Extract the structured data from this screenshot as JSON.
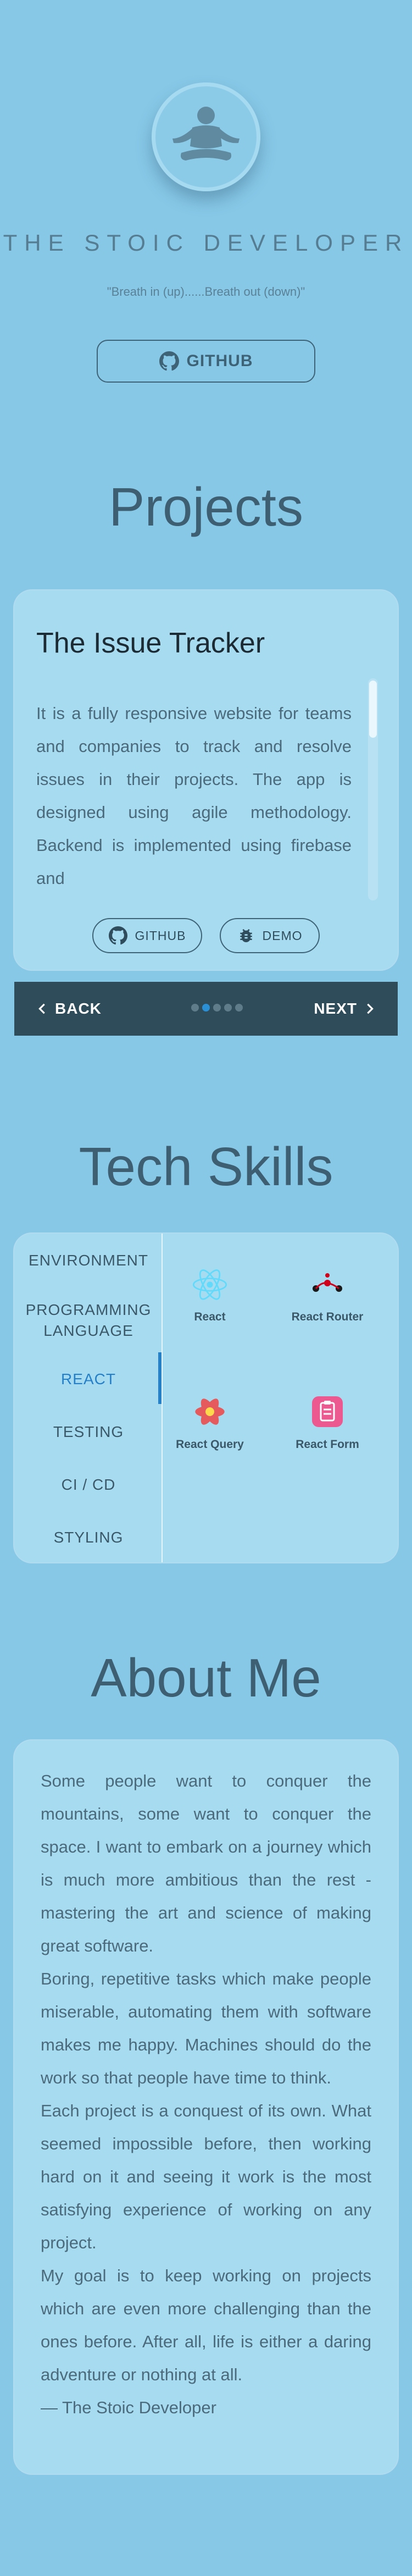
{
  "header": {
    "title": "THE STOIC DEVELOPER",
    "quote": "\"Breath in (up)......Breath out (down)\"",
    "github_label": "GITHUB"
  },
  "projects": {
    "heading": "Projects",
    "current": {
      "title": "The Issue Tracker",
      "description": "It is a fully responsive website for teams and companies to track and resolve issues in their projects. The app is designed using agile methodology. Backend is implemented using firebase and",
      "github_label": "GITHUB",
      "demo_label": "DEMO"
    },
    "stepper": {
      "back_label": "BACK",
      "next_label": "NEXT",
      "total_steps": 5,
      "active_step": 2
    }
  },
  "skills": {
    "heading": "Tech Skills",
    "tabs": [
      "ENVIRONMENT",
      "PROGRAMMING LANGUAGE",
      "REACT",
      "TESTING",
      "CI / CD",
      "STYLING"
    ],
    "active_tab": "REACT",
    "items": [
      {
        "label": "React",
        "icon": "react-icon"
      },
      {
        "label": "React Router",
        "icon": "react-router-icon"
      },
      {
        "label": "React Query",
        "icon": "react-query-icon"
      },
      {
        "label": "React Form",
        "icon": "react-form-icon"
      }
    ]
  },
  "about": {
    "heading": "About Me",
    "paragraphs": [
      "Some people want to conquer the mountains, some want to conquer the space. I want to embark on a journey which is much more ambitious than the rest - mastering the art and science of making great software.",
      "Boring, repetitive tasks which make people miserable, automating them with software makes me happy. Machines should do the work so that people have time to think.",
      "Each project is a conquest of its own. What seemed impossible before, then working hard on it and seeing it work is the most satisfying experience of working on any project.",
      "My goal is to keep working on projects which are even more challenging than the ones before. After all, life is either a daring adventure or nothing at all."
    ],
    "signature": "— The Stoic Developer"
  },
  "colors": {
    "background": "#87c8e7",
    "card": "#a6dbf0",
    "text": "#3e5f72",
    "accent": "#2680c8",
    "stepper": "#2f4c5a"
  }
}
